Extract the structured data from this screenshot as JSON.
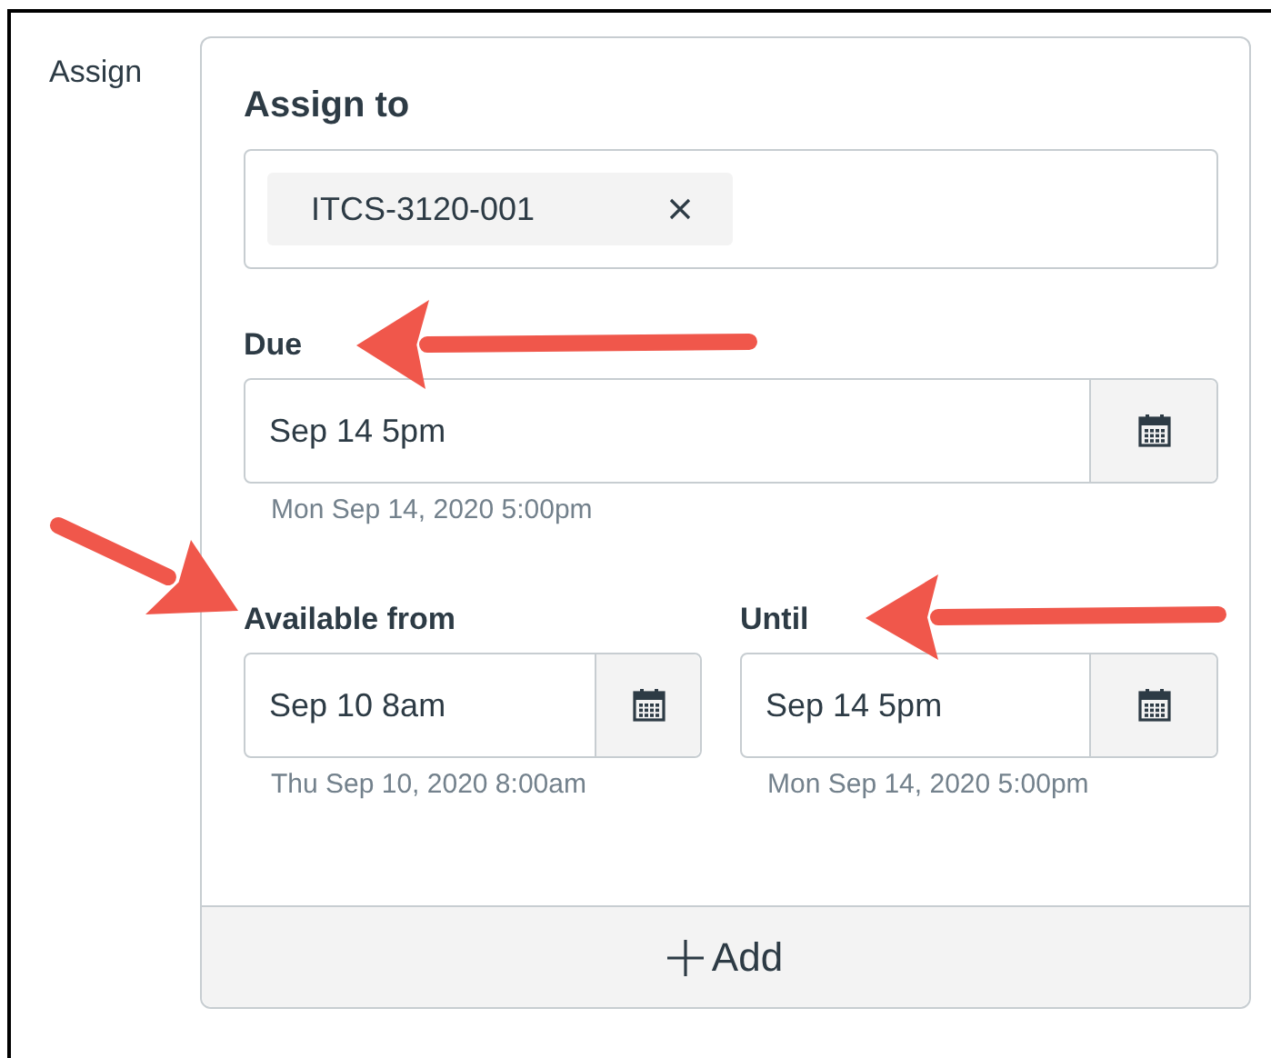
{
  "section_label": "Assign",
  "assign_to": {
    "label": "Assign to",
    "chips": [
      {
        "text": "ITCS-3120-001"
      }
    ]
  },
  "due": {
    "label": "Due",
    "value": "Sep 14 5pm",
    "hint": "Mon Sep 14, 2020 5:00pm"
  },
  "range": [
    {
      "label": "Available from",
      "value": "Sep 10 8am",
      "hint": "Thu Sep 10, 2020 8:00am"
    },
    {
      "label": "Until",
      "value": "Sep 14 5pm",
      "hint": "Mon Sep 14, 2020 5:00pm"
    }
  ],
  "add_button": "Add"
}
